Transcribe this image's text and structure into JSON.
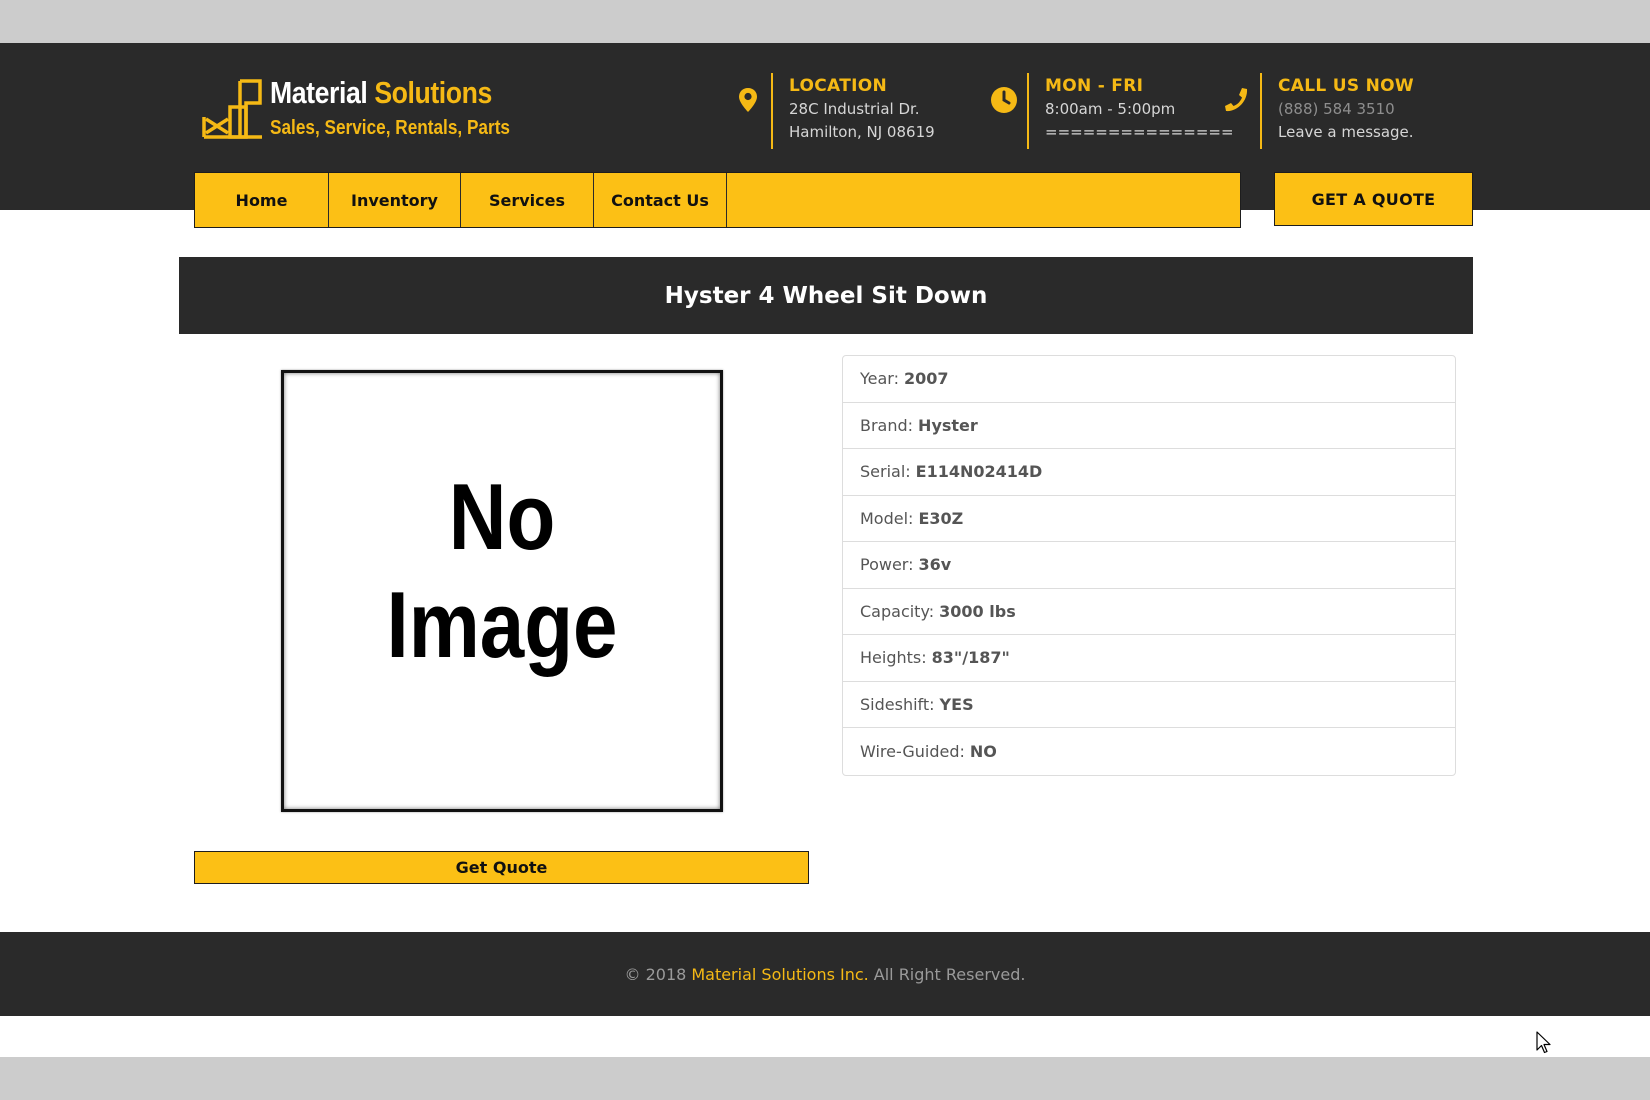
{
  "logo": {
    "name_white": "Material",
    "name_yellow": "Solutions",
    "tagline": "Sales, Service, Rentals, Parts"
  },
  "header_info": {
    "location": {
      "icon": "map-pin-icon",
      "title": "LOCATION",
      "line1": "28C Industrial Dr.",
      "line2": "Hamilton, NJ 08619"
    },
    "hours": {
      "icon": "clock-icon",
      "title": "MON - FRI",
      "line1": "8:00am - 5:00pm",
      "line2": "==============="
    },
    "call": {
      "icon": "phone-icon",
      "title": "CALL US NOW",
      "line1": "(888) 584 3510",
      "line2": "Leave a message."
    }
  },
  "nav": {
    "items": [
      {
        "label": "Home"
      },
      {
        "label": "Inventory"
      },
      {
        "label": "Services"
      },
      {
        "label": "Contact Us"
      }
    ],
    "quote_button": "GET A QUOTE"
  },
  "page_title": "Hyster 4 Wheel Sit Down",
  "image": {
    "placeholder_line1": "No",
    "placeholder_line2": "Image"
  },
  "get_quote_button": "Get Quote",
  "specs": [
    {
      "label": "Year:",
      "value": "2007"
    },
    {
      "label": "Brand:",
      "value": "Hyster"
    },
    {
      "label": "Serial:",
      "value": "E114N02414D"
    },
    {
      "label": "Model:",
      "value": "E30Z"
    },
    {
      "label": "Power:",
      "value": "36v"
    },
    {
      "label": "Capacity:",
      "value": "3000 lbs"
    },
    {
      "label": "Heights:",
      "value": "83\"/187\""
    },
    {
      "label": "Sideshift:",
      "value": "YES"
    },
    {
      "label": "Wire-Guided:",
      "value": "NO"
    }
  ],
  "footer": {
    "prefix": "© 2018",
    "brand": "Material Solutions Inc.",
    "suffix": "All Right Reserved."
  },
  "colors": {
    "accent": "#fcc015",
    "dark": "#2a2a2a",
    "background": "#cccccc"
  }
}
